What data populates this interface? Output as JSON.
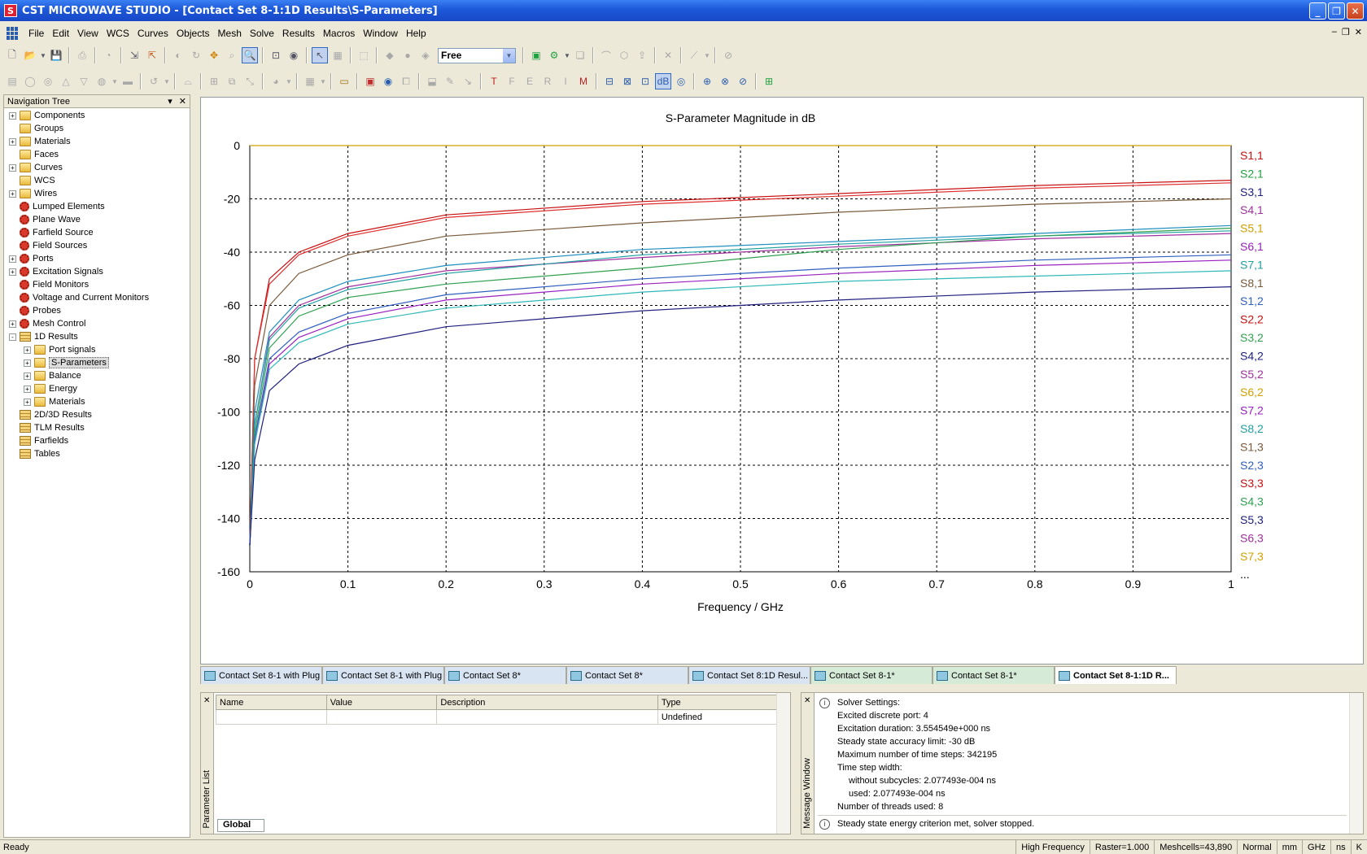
{
  "window": {
    "title": "CST MICROWAVE STUDIO - [Contact Set 8-1:1D Results\\S-Parameters]",
    "app_icon": "S"
  },
  "menu": [
    "File",
    "Edit",
    "View",
    "WCS",
    "Curves",
    "Objects",
    "Mesh",
    "Solve",
    "Results",
    "Macros",
    "Window",
    "Help"
  ],
  "toolbar": {
    "mode_combo": "Free"
  },
  "nav": {
    "title": "Navigation Tree",
    "items": [
      {
        "label": "Components",
        "level": 0,
        "expander": "+",
        "icon": "folder"
      },
      {
        "label": "Groups",
        "level": 0,
        "expander": "",
        "icon": "folder"
      },
      {
        "label": "Materials",
        "level": 0,
        "expander": "+",
        "icon": "folder"
      },
      {
        "label": "Faces",
        "level": 0,
        "expander": "",
        "icon": "folder"
      },
      {
        "label": "Curves",
        "level": 0,
        "expander": "+",
        "icon": "folder"
      },
      {
        "label": "WCS",
        "level": 0,
        "expander": "",
        "icon": "folder"
      },
      {
        "label": "Wires",
        "level": 0,
        "expander": "+",
        "icon": "folder"
      },
      {
        "label": "Lumped Elements",
        "level": 0,
        "expander": "",
        "icon": "gear"
      },
      {
        "label": "Plane Wave",
        "level": 0,
        "expander": "",
        "icon": "gear"
      },
      {
        "label": "Farfield Source",
        "level": 0,
        "expander": "",
        "icon": "gear"
      },
      {
        "label": "Field Sources",
        "level": 0,
        "expander": "",
        "icon": "gear"
      },
      {
        "label": "Ports",
        "level": 0,
        "expander": "+",
        "icon": "gear"
      },
      {
        "label": "Excitation Signals",
        "level": 0,
        "expander": "+",
        "icon": "gear"
      },
      {
        "label": "Field Monitors",
        "level": 0,
        "expander": "",
        "icon": "gear"
      },
      {
        "label": "Voltage and Current Monitors",
        "level": 0,
        "expander": "",
        "icon": "gear"
      },
      {
        "label": "Probes",
        "level": 0,
        "expander": "",
        "icon": "gear"
      },
      {
        "label": "Mesh Control",
        "level": 0,
        "expander": "+",
        "icon": "gear"
      },
      {
        "label": "1D Results",
        "level": 0,
        "expander": "-",
        "icon": "stack"
      },
      {
        "label": "Port signals",
        "level": 1,
        "expander": "+",
        "icon": "folder"
      },
      {
        "label": "S-Parameters",
        "level": 1,
        "expander": "+",
        "icon": "folder",
        "selected": true
      },
      {
        "label": "Balance",
        "level": 1,
        "expander": "+",
        "icon": "folder"
      },
      {
        "label": "Energy",
        "level": 1,
        "expander": "+",
        "icon": "folder"
      },
      {
        "label": "Materials",
        "level": 1,
        "expander": "+",
        "icon": "folder"
      },
      {
        "label": "2D/3D Results",
        "level": 0,
        "expander": "",
        "icon": "stack"
      },
      {
        "label": "TLM Results",
        "level": 0,
        "expander": "",
        "icon": "stack"
      },
      {
        "label": "Farfields",
        "level": 0,
        "expander": "",
        "icon": "stack"
      },
      {
        "label": "Tables",
        "level": 0,
        "expander": "",
        "icon": "stack"
      }
    ]
  },
  "chart_data": {
    "type": "line",
    "title": "S-Parameter Magnitude in dB",
    "xlabel": "Frequency / GHz",
    "ylabel": "",
    "xlim": [
      0,
      1
    ],
    "ylim": [
      -160,
      0
    ],
    "xticks": [
      "0",
      "0.1",
      "0.2",
      "0.3",
      "0.4",
      "0.5",
      "0.6",
      "0.7",
      "0.8",
      "0.9",
      "1"
    ],
    "yticks": [
      "0",
      "-20",
      "-40",
      "-60",
      "-80",
      "-100",
      "-120",
      "-140",
      "-160"
    ],
    "grid": true,
    "legend_more": "...",
    "series": [
      {
        "name": "S1,1",
        "color": "#d0a000",
        "kind": "flat",
        "values": [
          [
            0,
            0
          ],
          [
            1,
            0
          ]
        ]
      },
      {
        "name": "S2,1",
        "color": "#c81010",
        "values": [
          [
            0.005,
            -80
          ],
          [
            0.02,
            -50
          ],
          [
            0.05,
            -40
          ],
          [
            0.1,
            -33
          ],
          [
            0.2,
            -26
          ],
          [
            0.4,
            -21
          ],
          [
            0.6,
            -18
          ],
          [
            0.8,
            -15
          ],
          [
            1,
            -13
          ]
        ]
      },
      {
        "name": "S3,1",
        "color": "#e03030",
        "values": [
          [
            0.005,
            -80
          ],
          [
            0.02,
            -52
          ],
          [
            0.05,
            -41
          ],
          [
            0.1,
            -34
          ],
          [
            0.2,
            -27
          ],
          [
            0.4,
            -22
          ],
          [
            0.6,
            -19
          ],
          [
            0.8,
            -16
          ],
          [
            1,
            -14
          ]
        ]
      },
      {
        "name": "S4,1",
        "color": "#7a5a3a",
        "values": [
          [
            0.005,
            -90
          ],
          [
            0.02,
            -60
          ],
          [
            0.05,
            -48
          ],
          [
            0.1,
            -41
          ],
          [
            0.2,
            -34
          ],
          [
            0.4,
            -29
          ],
          [
            0.6,
            -25
          ],
          [
            0.8,
            -22
          ],
          [
            1,
            -20
          ]
        ]
      },
      {
        "name": "S5,1",
        "color": "#1f8fbf",
        "values": [
          [
            0.005,
            -100
          ],
          [
            0.02,
            -70
          ],
          [
            0.05,
            -58
          ],
          [
            0.1,
            -51
          ],
          [
            0.2,
            -45
          ],
          [
            0.4,
            -39
          ],
          [
            0.6,
            -36
          ],
          [
            0.8,
            -33
          ],
          [
            1,
            -30
          ]
        ]
      },
      {
        "name": "S6,1",
        "color": "#a030a0",
        "values": [
          [
            0.005,
            -105
          ],
          [
            0.02,
            -72
          ],
          [
            0.05,
            -60
          ],
          [
            0.1,
            -53
          ],
          [
            0.2,
            -47
          ],
          [
            0.4,
            -42
          ],
          [
            0.6,
            -38
          ],
          [
            0.8,
            -35
          ],
          [
            1,
            -33
          ]
        ]
      },
      {
        "name": "S7,1",
        "color": "#20a0a0",
        "values": [
          [
            0.005,
            -105
          ],
          [
            0.02,
            -73
          ],
          [
            0.05,
            -61
          ],
          [
            0.1,
            -54
          ],
          [
            0.2,
            -48
          ],
          [
            0.4,
            -41
          ],
          [
            0.6,
            -37
          ],
          [
            0.8,
            -34
          ],
          [
            1,
            -32
          ]
        ]
      },
      {
        "name": "S8,1",
        "color": "#30a050",
        "values": [
          [
            0.005,
            -108
          ],
          [
            0.02,
            -76
          ],
          [
            0.05,
            -64
          ],
          [
            0.1,
            -57
          ],
          [
            0.2,
            -52
          ],
          [
            0.4,
            -46
          ],
          [
            0.6,
            -39
          ],
          [
            0.8,
            -34
          ],
          [
            1,
            -31
          ]
        ]
      },
      {
        "name": "S1,2",
        "color": "#3060c0",
        "values": [
          [
            0.005,
            -110
          ],
          [
            0.02,
            -80
          ],
          [
            0.05,
            -70
          ],
          [
            0.1,
            -63
          ],
          [
            0.2,
            -56
          ],
          [
            0.4,
            -50
          ],
          [
            0.6,
            -46
          ],
          [
            0.8,
            -43
          ],
          [
            1,
            -41
          ]
        ]
      },
      {
        "name": "S2,2",
        "color": "#9a20c0",
        "values": [
          [
            0.005,
            -112
          ],
          [
            0.02,
            -82
          ],
          [
            0.05,
            -72
          ],
          [
            0.1,
            -65
          ],
          [
            0.2,
            -58
          ],
          [
            0.4,
            -52
          ],
          [
            0.6,
            -48
          ],
          [
            0.8,
            -45
          ],
          [
            1,
            -43
          ]
        ]
      },
      {
        "name": "S3,2",
        "color": "#30b8b8",
        "values": [
          [
            0.005,
            -112
          ],
          [
            0.02,
            -84
          ],
          [
            0.05,
            -74
          ],
          [
            0.1,
            -67
          ],
          [
            0.2,
            -61
          ],
          [
            0.4,
            -55
          ],
          [
            0.6,
            -51
          ],
          [
            0.8,
            -49
          ],
          [
            1,
            -47
          ]
        ]
      },
      {
        "name": "S4,2",
        "color": "#202080",
        "values": [
          [
            0.005,
            -118
          ],
          [
            0.02,
            -92
          ],
          [
            0.05,
            -82
          ],
          [
            0.1,
            -75
          ],
          [
            0.2,
            -68
          ],
          [
            0.4,
            -62
          ],
          [
            0.6,
            -58
          ],
          [
            0.8,
            -55
          ],
          [
            1,
            -53
          ]
        ]
      }
    ],
    "legend": [
      "S1,1",
      "S2,1",
      "S3,1",
      "S4,1",
      "S5,1",
      "S6,1",
      "S7,1",
      "S8,1",
      "S1,2",
      "S2,2",
      "S3,2",
      "S4,2",
      "S5,2",
      "S6,2",
      "S7,2",
      "S8,2",
      "S1,3",
      "S2,3",
      "S3,3",
      "S4,3",
      "S5,3",
      "S6,3",
      "S7,3"
    ],
    "legend_colors": [
      "#c81010",
      "#20a040",
      "#202080",
      "#a030a0",
      "#d0a000",
      "#9a20c0",
      "#20a0a0",
      "#7a5a3a",
      "#3060c0",
      "#c81010",
      "#30a050",
      "#202080",
      "#a030a0",
      "#d0a000",
      "#9a20c0",
      "#20a0a0",
      "#7a5a3a",
      "#3060c0",
      "#c81010",
      "#30a050",
      "#202080",
      "#a030a0",
      "#d0a000"
    ]
  },
  "doc_tabs": [
    {
      "label": "Contact Set 8-1 with Plug",
      "style": "blue"
    },
    {
      "label": "Contact Set 8-1 with Plug",
      "style": "blue"
    },
    {
      "label": "Contact Set 8*",
      "style": "blue"
    },
    {
      "label": "Contact Set 8*",
      "style": "blue"
    },
    {
      "label": "Contact Set 8:1D Resul...",
      "style": "blue"
    },
    {
      "label": "Contact Set 8-1*",
      "style": "green"
    },
    {
      "label": "Contact Set 8-1*",
      "style": "green"
    },
    {
      "label": "Contact Set 8-1:1D R...",
      "style": "active"
    }
  ],
  "param_list": {
    "title": "Parameter List",
    "columns": [
      "Name",
      "Value",
      "Description",
      "Type"
    ],
    "rows": [
      [
        "",
        "",
        "",
        "Undefined"
      ]
    ],
    "tab": "Global"
  },
  "message_window": {
    "title": "Message Window",
    "lines": [
      {
        "text": "Solver Settings:",
        "icon": true,
        "indent": false
      },
      {
        "text": "Excited discrete port: 4",
        "icon": false,
        "indent": false
      },
      {
        "text": "Excitation duration: 3.554549e+000 ns",
        "icon": false,
        "indent": false
      },
      {
        "text": "Steady state accuracy limit: -30 dB",
        "icon": false,
        "indent": false
      },
      {
        "text": "Maximum number of time steps: 342195",
        "icon": false,
        "indent": false
      },
      {
        "text": "Time step width:",
        "icon": false,
        "indent": false
      },
      {
        "text": "without subcycles: 2.077493e-004 ns",
        "icon": false,
        "indent": true
      },
      {
        "text": "used: 2.077493e-004 ns",
        "icon": false,
        "indent": true
      },
      {
        "text": "Number of threads used: 8",
        "icon": false,
        "indent": false
      }
    ],
    "last": "Steady state energy criterion met, solver stopped."
  },
  "status": {
    "ready": "Ready",
    "cells": [
      "High Frequency",
      "Raster=1.000",
      "Meshcells=43,890",
      "Normal",
      "mm",
      "GHz",
      "ns",
      "K"
    ]
  }
}
